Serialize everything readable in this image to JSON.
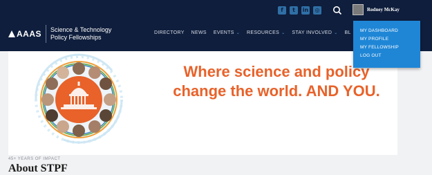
{
  "header": {
    "social": [
      {
        "name": "facebook-icon",
        "glyph": "f"
      },
      {
        "name": "twitter-icon",
        "glyph": "t"
      },
      {
        "name": "linkedin-icon",
        "glyph": "in"
      },
      {
        "name": "instagram-icon",
        "glyph": "◎"
      }
    ],
    "user": {
      "name": "Rodney McKay"
    },
    "logo": {
      "brand": "AAAS",
      "line1": "Science & Technology",
      "line2": "Policy Fellowships"
    },
    "nav": [
      {
        "label": "DIRECTORY",
        "dropdown": false
      },
      {
        "label": "NEWS",
        "dropdown": false
      },
      {
        "label": "EVENTS",
        "dropdown": true
      },
      {
        "label": "RESOURCES",
        "dropdown": true
      },
      {
        "label": "STAY INVOLVED",
        "dropdown": true
      },
      {
        "label": "BL",
        "dropdown": false
      }
    ],
    "user_menu": [
      "MY DASHBOARD",
      "MY PROFILE",
      "MY FELLOWSHIP",
      "LOG OUT"
    ]
  },
  "hero": {
    "headline_line1": "Where science and policy",
    "headline_line2": "change the world. AND YOU."
  },
  "section": {
    "eyebrow": "45+ YEARS OF IMPACT",
    "title": "About STPF"
  },
  "colors": {
    "navy": "#0f1e3c",
    "accent": "#1f86d6",
    "orange": "#e8622a"
  }
}
